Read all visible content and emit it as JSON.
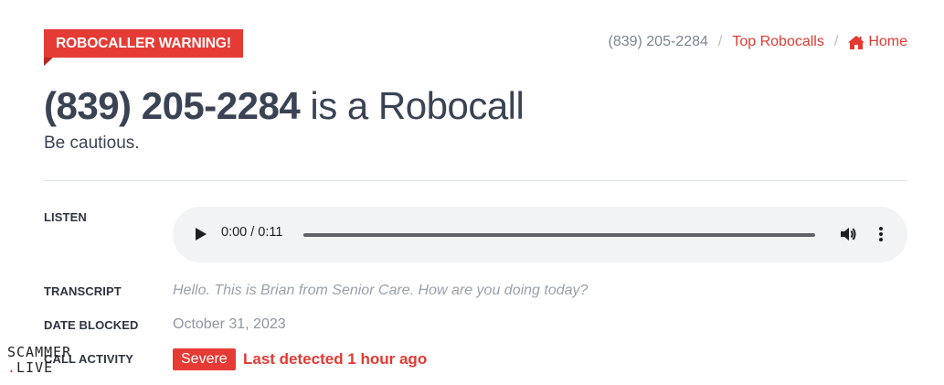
{
  "warning_tag": "ROBOCALLER WARNING!",
  "breadcrumb": {
    "current": "(839) 205-2284",
    "separator": "/",
    "top_robocalls": "Top Robocalls",
    "home": "Home"
  },
  "heading": {
    "number": "(839) 205-2284",
    "suffix": " is a Robocall"
  },
  "subtitle": "Be cautious.",
  "labels": {
    "listen": "LISTEN",
    "transcript": "TRANSCRIPT",
    "date_blocked": "DATE BLOCKED",
    "activity": "CALL ACTIVITY"
  },
  "audio": {
    "time": "0:00 / 0:11",
    "progress": 0
  },
  "transcript": "Hello. This is Brian from Senior Care. How are you doing today?",
  "date_blocked": "October 31, 2023",
  "activity": {
    "badge": "Severe",
    "detected": "Last detected 1 hour ago"
  },
  "watermark": {
    "line1": "SCAMMER",
    "line2": "LIVE"
  },
  "colors": {
    "accent": "#e63b35",
    "text": "#3a4354",
    "muted": "#9aa1ab"
  },
  "icons": [
    "home-icon",
    "play-icon",
    "volume-icon",
    "more-vert-icon"
  ]
}
